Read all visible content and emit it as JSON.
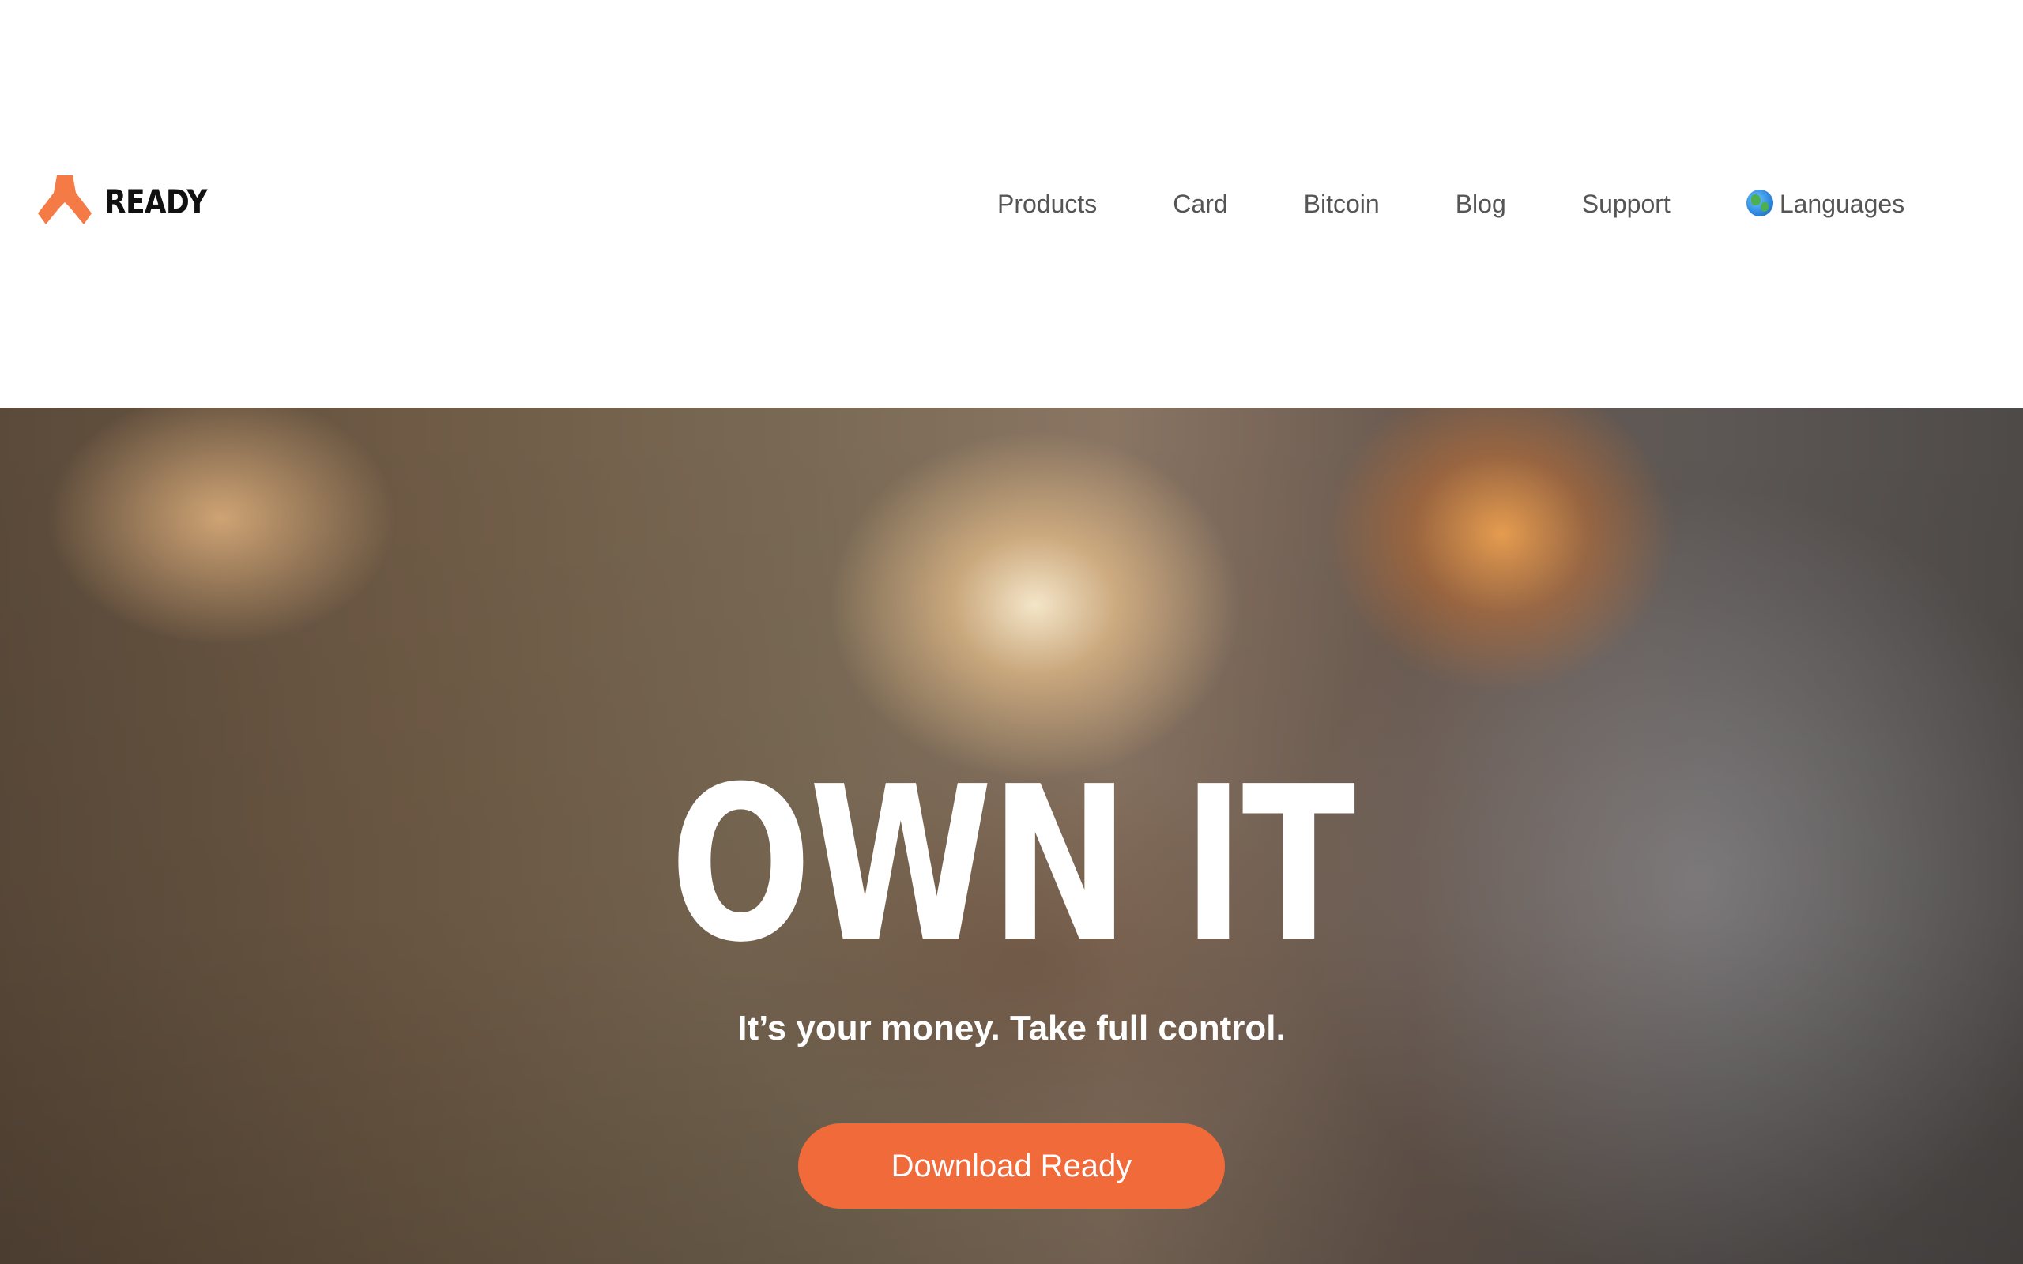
{
  "header": {
    "logo_text": "READY",
    "nav": [
      {
        "label": "Products"
      },
      {
        "label": "Card"
      },
      {
        "label": "Bitcoin"
      },
      {
        "label": "Blog"
      },
      {
        "label": "Support"
      },
      {
        "label": "Languages",
        "icon": "globe-icon"
      }
    ]
  },
  "hero": {
    "title": "OWN IT",
    "subtitle": "It’s your money. Take full control.",
    "cta_label": "Download Ready"
  },
  "colors": {
    "accent": "#f06a3a",
    "logo_mark": "#f47b45",
    "nav_text": "#555555",
    "logo_text": "#111111"
  }
}
